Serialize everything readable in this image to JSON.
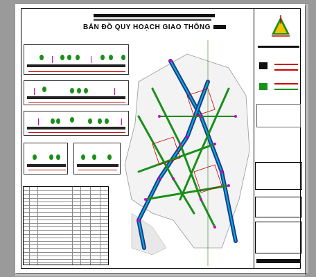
{
  "window": {
    "page_title": "BẢN ĐỒ QUY HOẠCH GIAO THÔNG"
  },
  "logo": {
    "name": "logo-icon"
  },
  "colors": {
    "background": "#9a9a9a",
    "sheet": "#ffffff",
    "road_cyan": "#00b4d8",
    "road_green": "#1a8f1a",
    "magenta_markers": "#d000d0",
    "red_lines": "#cc0000",
    "dark_blue": "#1f3a8a"
  },
  "sections": [
    {
      "name": "cross-section-1"
    },
    {
      "name": "cross-section-2"
    },
    {
      "name": "cross-section-3"
    },
    {
      "name": "cross-section-4"
    },
    {
      "name": "cross-section-5"
    }
  ]
}
